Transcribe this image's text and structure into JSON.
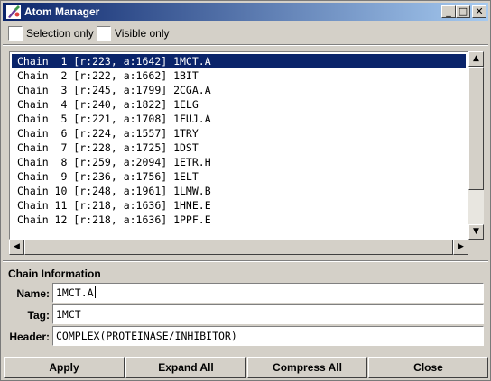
{
  "window": {
    "title": "Atom Manager"
  },
  "title_buttons": {
    "minimize": "_",
    "maximize": "□",
    "close": "✕"
  },
  "options": {
    "selection_only_label": "Selection only",
    "visible_only_label": "Visible only"
  },
  "chains": [
    {
      "text": "Chain  1 [r:223, a:1642] 1MCT.A",
      "selected": true
    },
    {
      "text": "Chain  2 [r:222, a:1662] 1BIT"
    },
    {
      "text": "Chain  3 [r:245, a:1799] 2CGA.A"
    },
    {
      "text": "Chain  4 [r:240, a:1822] 1ELG"
    },
    {
      "text": "Chain  5 [r:221, a:1708] 1FUJ.A"
    },
    {
      "text": "Chain  6 [r:224, a:1557] 1TRY"
    },
    {
      "text": "Chain  7 [r:228, a:1725] 1DST"
    },
    {
      "text": "Chain  8 [r:259, a:2094] 1ETR.H"
    },
    {
      "text": "Chain  9 [r:236, a:1756] 1ELT"
    },
    {
      "text": "Chain 10 [r:248, a:1961] 1LMW.B"
    },
    {
      "text": "Chain 11 [r:218, a:1636] 1HNE.E"
    },
    {
      "text": "Chain 12 [r:218, a:1636] 1PPF.E"
    }
  ],
  "scroll": {
    "up": "▲",
    "down": "▼",
    "left": "◀",
    "right": "▶"
  },
  "chain_info": {
    "title": "Chain Information",
    "name_label": "Name:",
    "name_value": "1MCT.A",
    "tag_label": "Tag:",
    "tag_value": "1MCT",
    "header_label": "Header:",
    "header_value": "COMPLEX(PROTEINASE/INHIBITOR)"
  },
  "buttons": {
    "apply": "Apply",
    "expand_all": "Expand All",
    "compress_all": "Compress All",
    "close": "Close"
  },
  "colors": {
    "selection": "#0a246a",
    "face": "#d4d0c8",
    "title_gradient_start": "#0a246a",
    "title_gradient_end": "#a6caf0"
  }
}
